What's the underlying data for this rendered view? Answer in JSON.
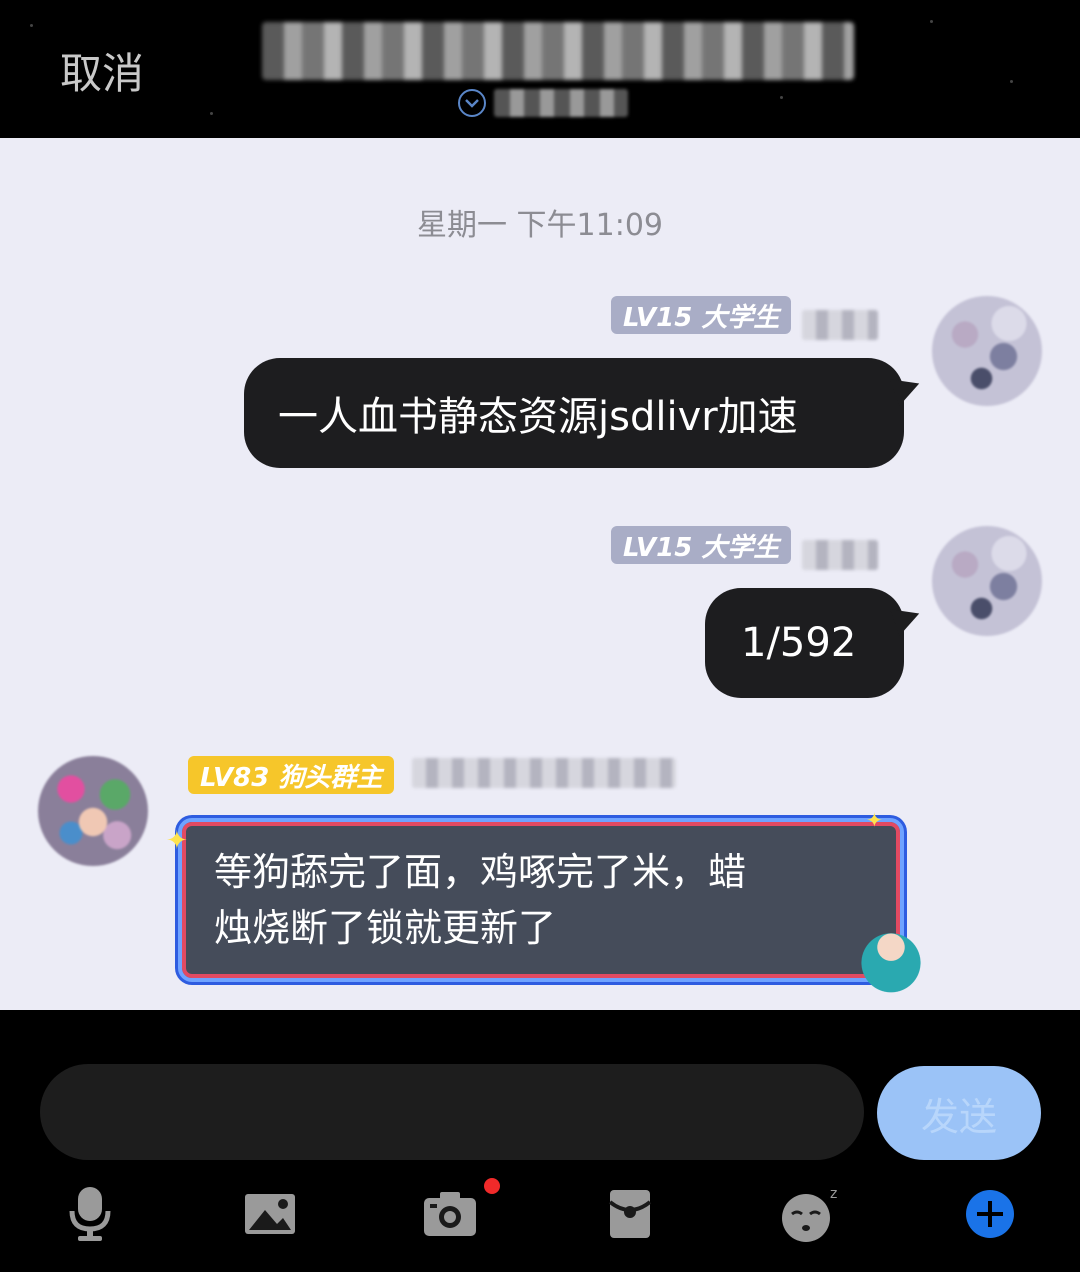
{
  "header": {
    "cancel_label": "取消"
  },
  "chat": {
    "timestamp": "星期一 下午11:09",
    "messages": [
      {
        "badge": "LV15 大学生",
        "text": "一人血书静态资源jsdlivr加速"
      },
      {
        "badge": "LV15 大学生",
        "text": "1/592"
      },
      {
        "badge": "LV83 狗头群主",
        "text_line1": "等狗舔完了面，鸡啄完了米，蜡",
        "text_line2": "烛烧断了锁就更新了"
      }
    ]
  },
  "composer": {
    "input_value": "",
    "send_label": "发送"
  },
  "toolbar": {
    "items": [
      "microphone-icon",
      "image-icon",
      "camera-icon",
      "red-packet-icon",
      "emoji-sleepy-icon",
      "plus-icon"
    ]
  },
  "colors": {
    "bubble_dark": "#1d1d1f",
    "chat_bg": "#ececf6",
    "send_button": "#9bc3f7",
    "badge_lv15": "#a9adc6",
    "badge_lv83": "#f6c62a",
    "plus_button": "#1a73e8"
  }
}
